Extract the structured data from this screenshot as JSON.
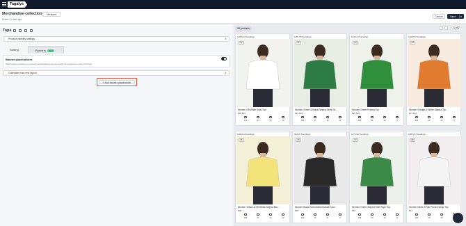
{
  "app": {
    "logo": "Tagalys"
  },
  "header": {
    "title": "Merchandise collection",
    "saved": "Edited 21 days ago",
    "versions_label": "Versions",
    "cancel_label": "Cancel",
    "save_label": "Save",
    "save_caret": "▾"
  },
  "category": {
    "title": "Tops"
  },
  "visibility_select": {
    "label": "Product visibility settings",
    "chevron": "⇕"
  },
  "tabs": {
    "sorting": "Sorting",
    "banners": "Banners",
    "new_badge": "New"
  },
  "banner_placeholders": {
    "title": "Banner placeholders",
    "desc": "Mark banner positions to preview merchandising layout exactly as it appears on the storefront",
    "enabled": true
  },
  "layout_select": {
    "label": "Collection front-end layout",
    "chevron": "⇕"
  },
  "add_banner": {
    "label": "+ Add banner placeholder"
  },
  "results": {
    "count_label": "53 products",
    "page_label": "1 of 2"
  },
  "products": [
    {
      "head": "125.53 (Trending)",
      "rank": "#1",
      "name": "Women Off-White Solid Top",
      "price": "$40  $57",
      "stats": [
        "270",
        "56",
        "38",
        "10"
      ]
    },
    {
      "head": "120.78 (Trending)",
      "rank": "#2",
      "name": "Women Green & Black Striped Semi-Sh...",
      "price": "$15  $32",
      "stats": [
        "266",
        "57",
        "40",
        "11"
      ]
    },
    {
      "head": "113.41 (Trending)",
      "rank": "#3",
      "name": "Women Green Printed Top",
      "price": "$20  $29",
      "stats": [
        "248",
        "51",
        "33",
        "9"
      ]
    },
    {
      "head": "102.87 (Trending)",
      "rank": "#4",
      "name": "Women Orange & White Striped Top",
      "price": "$17  $34",
      "stats": [
        "225",
        "48",
        "30",
        "9"
      ]
    },
    {
      "head": "139.04 (Trending)",
      "rank": "#5",
      "name": "Women Yellow & Off-White Striped Bar...",
      "price": "$38",
      "stats": [
        "305",
        "61",
        "42",
        "12"
      ]
    },
    {
      "head": "98.57 (Trending)",
      "rank": "#6",
      "name": "Women Black Embroidered Detail Faux...",
      "price": "$45",
      "stats": [
        "212",
        "46",
        "31",
        "8"
      ]
    },
    {
      "head": "137.04 (Trending)",
      "rank": "#7",
      "name": "Women Green Striped Shirt Style Top",
      "price": "$45",
      "stats": [
        "298",
        "60",
        "40",
        "11"
      ]
    },
    {
      "head": "105.53 (Trending)",
      "rank": "#8",
      "name": "Women White &Pink Printed Wrap Top",
      "price": "$47",
      "stats": [
        "230",
        "49",
        "33",
        "9"
      ]
    }
  ]
}
